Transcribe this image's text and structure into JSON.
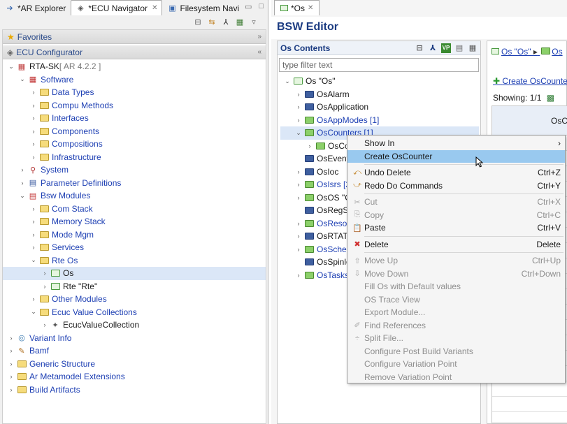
{
  "left": {
    "tabs": [
      {
        "label": "*AR Explorer"
      },
      {
        "label": "*ECU Navigator",
        "active": true
      },
      {
        "label": "Filesystem Navi"
      }
    ],
    "favorites": "Favorites",
    "configurator": "ECU Configurator",
    "tree": [
      {
        "d": 0,
        "t": "open",
        "i": "root",
        "label": "RTA-SK",
        "suffix": " [ AR 4.2.2 ]"
      },
      {
        "d": 1,
        "t": "open",
        "i": "sw",
        "label": "Software",
        "c": "blue"
      },
      {
        "d": 2,
        "t": "closed",
        "i": "f",
        "label": "Data Types",
        "c": "blue"
      },
      {
        "d": 2,
        "t": "closed",
        "i": "f",
        "label": "Compu Methods",
        "c": "blue"
      },
      {
        "d": 2,
        "t": "closed",
        "i": "f",
        "label": "Interfaces",
        "c": "blue"
      },
      {
        "d": 2,
        "t": "closed",
        "i": "f",
        "label": "Components",
        "c": "blue"
      },
      {
        "d": 2,
        "t": "closed",
        "i": "f",
        "label": "Compositions",
        "c": "blue"
      },
      {
        "d": 2,
        "t": "closed",
        "i": "f",
        "label": "Infrastructure",
        "c": "blue"
      },
      {
        "d": 1,
        "t": "closed",
        "i": "sys",
        "label": "System",
        "c": "blue"
      },
      {
        "d": 1,
        "t": "closed",
        "i": "param",
        "label": "Parameter Definitions",
        "c": "blue"
      },
      {
        "d": 1,
        "t": "open",
        "i": "bsw",
        "label": "Bsw Modules",
        "c": "blue"
      },
      {
        "d": 2,
        "t": "closed",
        "i": "f",
        "label": "Com Stack",
        "c": "blue"
      },
      {
        "d": 2,
        "t": "closed",
        "i": "f",
        "label": "Memory Stack",
        "c": "blue"
      },
      {
        "d": 2,
        "t": "closed",
        "i": "f",
        "label": "Mode Mgm",
        "c": "blue"
      },
      {
        "d": 2,
        "t": "closed",
        "i": "f",
        "label": "Services",
        "c": "blue"
      },
      {
        "d": 2,
        "t": "open",
        "i": "f",
        "label": "Rte Os",
        "c": "blue"
      },
      {
        "d": 3,
        "t": "closed",
        "i": "gbox",
        "label": "Os",
        "sel": true
      },
      {
        "d": 3,
        "t": "closed",
        "i": "gbox",
        "label": "Rte \"Rte\""
      },
      {
        "d": 2,
        "t": "closed",
        "i": "f",
        "label": "Other Modules",
        "c": "blue"
      },
      {
        "d": 2,
        "t": "open",
        "i": "f",
        "label": "Ecuc Value Collections",
        "c": "blue"
      },
      {
        "d": 3,
        "t": "closed",
        "i": "ecuc",
        "label": "EcucValueCollection"
      },
      {
        "d": 0,
        "t": "closed",
        "i": "variant",
        "label": "Variant Info",
        "c": "blue"
      },
      {
        "d": 0,
        "t": "closed",
        "i": "bamf",
        "label": "Bamf",
        "c": "blue"
      },
      {
        "d": 0,
        "t": "closed",
        "i": "f",
        "label": "Generic Structure",
        "c": "blue"
      },
      {
        "d": 0,
        "t": "closed",
        "i": "f",
        "label": "Ar Metamodel Extensions",
        "c": "blue"
      },
      {
        "d": 0,
        "t": "closed",
        "i": "f",
        "label": "Build Artifacts",
        "c": "blue"
      }
    ]
  },
  "right": {
    "tab": "*Os",
    "title": "BSW Editor",
    "contents_title": "Os Contents",
    "filter_placeholder": "type filter text",
    "tree": [
      {
        "d": 0,
        "t": "open",
        "i": "gbox",
        "label": "Os \"Os\""
      },
      {
        "d": 1,
        "t": "closed",
        "i": "b",
        "label": "OsAlarm"
      },
      {
        "d": 1,
        "t": "closed",
        "i": "b",
        "label": "OsApplication"
      },
      {
        "d": 1,
        "t": "closed",
        "i": "g",
        "label": "OsAppModes [1]",
        "c": "blue"
      },
      {
        "d": 1,
        "t": "open",
        "i": "g",
        "label": "OsCounters [1]",
        "c": "blue",
        "sel": true
      },
      {
        "d": 2,
        "t": "closed",
        "i": "g",
        "label": "OsCo"
      },
      {
        "d": 1,
        "t": "none",
        "i": "b",
        "label": "OsEvent"
      },
      {
        "d": 1,
        "t": "closed",
        "i": "b",
        "label": "OsIoc"
      },
      {
        "d": 1,
        "t": "closed",
        "i": "g",
        "label": "OsIsrs [2",
        "c": "blue"
      },
      {
        "d": 1,
        "t": "closed",
        "i": "g",
        "label": "OsOS \"C"
      },
      {
        "d": 1,
        "t": "none",
        "i": "b",
        "label": "OsRegSe"
      },
      {
        "d": 1,
        "t": "closed",
        "i": "g",
        "label": "OsResou",
        "c": "blue"
      },
      {
        "d": 1,
        "t": "closed",
        "i": "b",
        "label": "OsRTATa"
      },
      {
        "d": 1,
        "t": "closed",
        "i": "g",
        "label": "OsSchec",
        "c": "blue"
      },
      {
        "d": 1,
        "t": "none",
        "i": "b",
        "label": "OsSpinlo"
      },
      {
        "d": 1,
        "t": "closed",
        "i": "g",
        "label": "OsTasks",
        "c": "blue"
      }
    ],
    "breadcrumb": "Os \"Os\"",
    "breadcrumb_next": "Os",
    "create_link": "Create OsCounte",
    "showing": "Showing: 1/1",
    "col_header": "OsC"
  },
  "menu": [
    {
      "label": "Show In",
      "acc": "›",
      "icon": ""
    },
    {
      "label": "Create OsCounter",
      "acc": "",
      "icon": "",
      "hl": true
    },
    {
      "sep": true
    },
    {
      "label": "Undo Delete",
      "acc": "Ctrl+Z",
      "icon": "undo"
    },
    {
      "label": "Redo Do Commands",
      "acc": "Ctrl+Y",
      "icon": "redo"
    },
    {
      "sep": true
    },
    {
      "label": "Cut",
      "acc": "Ctrl+X",
      "icon": "cut",
      "dis": true
    },
    {
      "label": "Copy",
      "acc": "Ctrl+C",
      "icon": "copy",
      "dis": true
    },
    {
      "label": "Paste",
      "acc": "Ctrl+V",
      "icon": "paste"
    },
    {
      "sep": true
    },
    {
      "label": "Delete",
      "acc": "Delete",
      "icon": "delete"
    },
    {
      "sep": true
    },
    {
      "label": "Move Up",
      "acc": "Ctrl+Up",
      "icon": "up",
      "dis": true
    },
    {
      "label": "Move Down",
      "acc": "Ctrl+Down",
      "icon": "down",
      "dis": true
    },
    {
      "label": "Fill Os with Default values",
      "acc": "",
      "icon": "",
      "dis": true
    },
    {
      "label": "OS Trace View",
      "acc": "",
      "icon": "",
      "dis": true
    },
    {
      "label": "Export Module...",
      "acc": "",
      "icon": "",
      "dis": true
    },
    {
      "label": "Find References",
      "acc": "",
      "icon": "find",
      "dis": true
    },
    {
      "label": "Split File...",
      "acc": "",
      "icon": "split",
      "dis": true
    },
    {
      "label": "Configure Post Build Variants",
      "acc": "",
      "icon": "",
      "dis": true
    },
    {
      "label": "Configure Variation Point",
      "acc": "",
      "icon": "",
      "dis": true
    },
    {
      "label": "Remove Variation Point",
      "acc": "",
      "icon": "",
      "dis": true
    }
  ]
}
